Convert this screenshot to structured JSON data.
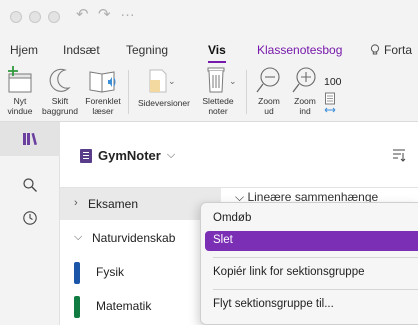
{
  "titlebar": {
    "quick_access_overflow": "…"
  },
  "ribbon_tabs": {
    "items": [
      "Hjem",
      "Indsæt",
      "Tegning",
      "Vis",
      "Klassenotesbog",
      "Forta"
    ],
    "active": "Vis",
    "accent_color": "#7719aa"
  },
  "ribbon": {
    "new_window": {
      "line1": "Nyt",
      "line2": "vindue",
      "icon": "new-window-icon"
    },
    "switch_background": {
      "line1": "Skift",
      "line2": "baggrund",
      "icon": "moon-icon"
    },
    "immersive_reader": {
      "line1": "Forenklet",
      "line2": "læser",
      "icon": "immersive-reader-icon"
    },
    "page_versions": {
      "line1": "Sideversioner",
      "icon": "page-versions-icon"
    },
    "deleted_notes": {
      "line1": "Slettede",
      "line2": "noter",
      "icon": "trash-icon"
    },
    "zoom_out": {
      "line1": "Zoom",
      "line2": "ud",
      "icon": "zoom-out-icon"
    },
    "zoom_in": {
      "line1": "Zoom",
      "line2": "ind",
      "icon": "zoom-in-icon"
    },
    "zoom_value": "100"
  },
  "rail": {
    "items": [
      "notebooks-icon",
      "search-icon",
      "recent-icon"
    ]
  },
  "notebook": {
    "name": "GymNoter",
    "color": "#5a3d8a"
  },
  "sections": {
    "eksamen": "Eksamen",
    "naturvidenskab": "Naturvidenskab",
    "fysik": {
      "label": "Fysik",
      "color": "#1b55a8"
    },
    "matematik": {
      "label": "Matematik",
      "color": "#107c41"
    }
  },
  "pages": {
    "partial_title": "Lineære sammenhænge"
  },
  "context_menu": {
    "items": [
      {
        "label": "Omdøb"
      },
      {
        "label": "Slet",
        "selected": true
      },
      {
        "label": "Kopiér link for sektionsgruppe"
      },
      {
        "label": "Flyt sektionsgruppe til..."
      }
    ],
    "highlight_color": "#7b2fb5"
  }
}
